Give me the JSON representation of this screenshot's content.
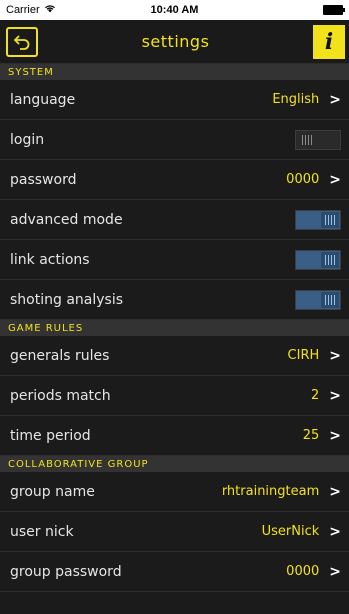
{
  "status": {
    "carrier": "Carrier",
    "time": "10:40 AM"
  },
  "nav": {
    "title": "settings",
    "info_label": "i"
  },
  "sections": [
    {
      "title": "SYSTEM"
    },
    {
      "title": "GAME RULES"
    },
    {
      "title": "COLLABORATIVE GROUP"
    }
  ],
  "rows": {
    "language": {
      "label": "language",
      "value": "English"
    },
    "login": {
      "label": "login",
      "toggle": false
    },
    "password": {
      "label": "password",
      "value": "0000"
    },
    "advanced_mode": {
      "label": "advanced mode",
      "toggle": true
    },
    "link_actions": {
      "label": "link actions",
      "toggle": true
    },
    "shoting_analysis": {
      "label": "shoting analysis",
      "toggle": true
    },
    "generals_rules": {
      "label": "generals rules",
      "value": "CIRH"
    },
    "periods_match": {
      "label": "periods match",
      "value": "2"
    },
    "time_period": {
      "label": "time period",
      "value": "25"
    },
    "group_name": {
      "label": "group name",
      "value": "rhtrainingteam"
    },
    "user_nick": {
      "label": "user nick",
      "value": "UserNick"
    },
    "group_password": {
      "label": "group password",
      "value": "0000"
    }
  },
  "colors": {
    "accent": "#f2e21c",
    "background": "#1b1b1b",
    "section_bg": "#333333",
    "toggle_on": "#3a5f86"
  }
}
